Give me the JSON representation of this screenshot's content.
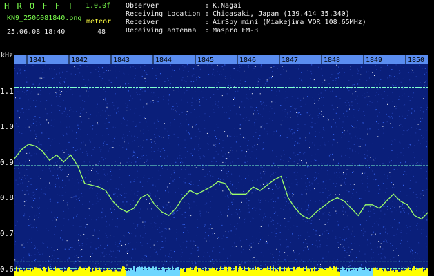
{
  "header": {
    "app_name": "H R O F F T",
    "version": "1.0.0f",
    "filename": "KN9_2506081840.png",
    "datetime": "25.06.08 18:40",
    "count_label": "meteor",
    "count_value": "48",
    "info": [
      {
        "label": "Observer",
        "sep": ":",
        "value": "K.Nagai"
      },
      {
        "label": "Receiving Location",
        "sep": ":",
        "value": "Chigasaki, Japan (139.414 35.340)"
      },
      {
        "label": "Receiver",
        "sep": ":",
        "value": "AirSpy mini (Miakejima VOR 108.65MHz)"
      },
      {
        "label": "Receiving antenna",
        "sep": ":",
        "value": "Maspro FM-3"
      }
    ]
  },
  "spectrogram": {
    "unit": "kHz",
    "time_ticks": [
      "1841",
      "1842",
      "1843",
      "1844",
      "1845",
      "1846",
      "1847",
      "1848",
      "1849",
      "1850"
    ],
    "freq_ticks": [
      "1.1",
      "1.0",
      "0.9",
      "0.8",
      "0.7",
      "0.6"
    ],
    "freq_range": [
      0.58,
      1.2
    ],
    "background_color": "#0a1f7a",
    "noise_color": "#3a6dff",
    "trace_color": "#9dff6a",
    "line_color": "#7fffd0",
    "bottom_bar_color": "#ffff00",
    "constant_lines": [
      1.11,
      0.89,
      0.62,
      0.6
    ],
    "trace": [
      [
        0,
        0.91
      ],
      [
        1,
        0.935
      ],
      [
        2,
        0.95
      ],
      [
        3,
        0.945
      ],
      [
        4,
        0.93
      ],
      [
        5,
        0.905
      ],
      [
        6,
        0.92
      ],
      [
        7,
        0.9
      ],
      [
        8,
        0.92
      ],
      [
        9,
        0.89
      ],
      [
        10,
        0.84
      ],
      [
        11,
        0.835
      ],
      [
        12,
        0.83
      ],
      [
        13,
        0.82
      ],
      [
        14,
        0.79
      ],
      [
        15,
        0.77
      ],
      [
        16,
        0.76
      ],
      [
        17,
        0.77
      ],
      [
        18,
        0.8
      ],
      [
        19,
        0.81
      ],
      [
        20,
        0.78
      ],
      [
        21,
        0.76
      ],
      [
        22,
        0.75
      ],
      [
        23,
        0.77
      ],
      [
        24,
        0.8
      ],
      [
        25,
        0.82
      ],
      [
        26,
        0.81
      ],
      [
        27,
        0.82
      ],
      [
        28,
        0.83
      ],
      [
        29,
        0.845
      ],
      [
        30,
        0.84
      ],
      [
        31,
        0.81
      ],
      [
        32,
        0.81
      ],
      [
        33,
        0.81
      ],
      [
        34,
        0.83
      ],
      [
        35,
        0.82
      ],
      [
        36,
        0.835
      ],
      [
        37,
        0.85
      ],
      [
        38,
        0.86
      ],
      [
        39,
        0.8
      ],
      [
        40,
        0.77
      ],
      [
        41,
        0.75
      ],
      [
        42,
        0.74
      ],
      [
        43,
        0.76
      ],
      [
        44,
        0.775
      ],
      [
        45,
        0.79
      ],
      [
        46,
        0.8
      ],
      [
        47,
        0.79
      ],
      [
        48,
        0.77
      ],
      [
        49,
        0.75
      ],
      [
        50,
        0.78
      ],
      [
        51,
        0.78
      ],
      [
        52,
        0.77
      ],
      [
        53,
        0.79
      ],
      [
        54,
        0.81
      ],
      [
        55,
        0.79
      ],
      [
        56,
        0.78
      ],
      [
        57,
        0.75
      ],
      [
        58,
        0.74
      ],
      [
        59,
        0.76
      ]
    ]
  }
}
